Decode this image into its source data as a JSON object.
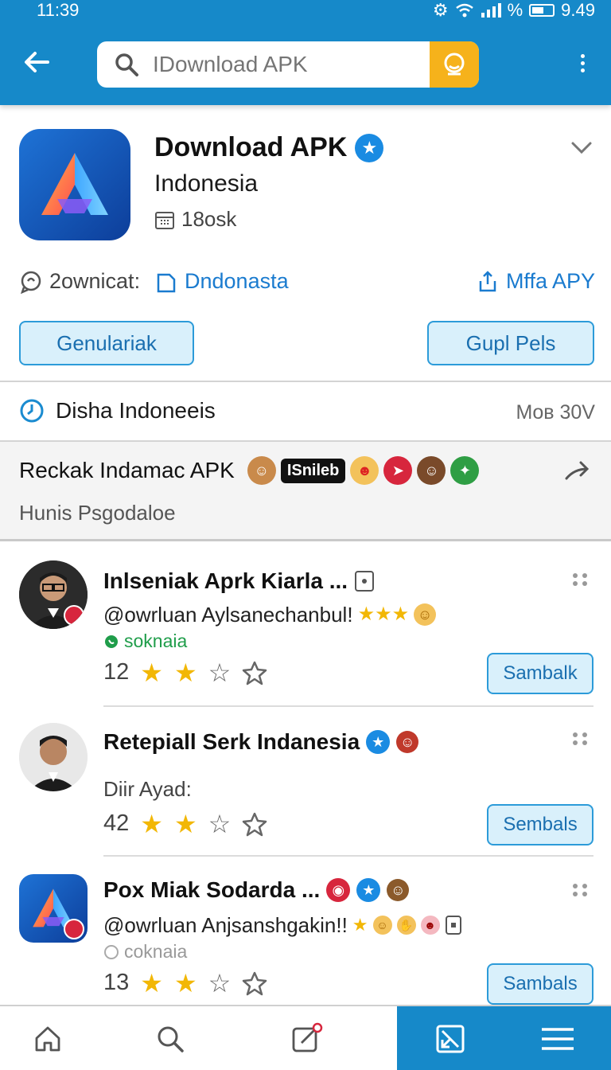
{
  "status_bar": {
    "time": "11:39",
    "percent_sign": "%",
    "battery_value": "9.49"
  },
  "search": {
    "placeholder": "IDownload APK"
  },
  "app": {
    "title": "Download APK",
    "subtitle": "Indonesia",
    "meta": "18osk",
    "info": {
      "downloads": "2ownicat:",
      "source": "Dndonasta",
      "share": "Mffa APY"
    },
    "buttons": {
      "left": "Genulariak",
      "right": "Gupl Pels"
    }
  },
  "time_row": {
    "label": "Disha Indoneeis",
    "value": "Moв 30V"
  },
  "recommend": {
    "title": "Reckak Indamac APK",
    "pill": "ISnileb",
    "subtitle": "Hunis Psgodaloe"
  },
  "reviews": [
    {
      "name": "Inlseniak Aprk Kiarla ...",
      "text": "@owrluan Aylsanechanbul!",
      "tag": "soknaia",
      "count": "12",
      "rating": 2,
      "button": "Sambalk"
    },
    {
      "name": "Retepiall Serk Indanesia",
      "text": "Diir Ayad:",
      "tag": "",
      "count": "42",
      "rating": 2,
      "button": "Sembals"
    },
    {
      "name": "Pox Miak Sodarda ...",
      "text": "@owrluan Anjsanshgakin!!",
      "tag": "coknaia",
      "count": "13",
      "rating": 2,
      "button": "Sambals"
    }
  ],
  "colors": {
    "primary": "#1689c9",
    "accent": "#f6b21b",
    "star": "#f2b705",
    "button_fill": "#d9f0fb"
  },
  "icons": [
    "back-arrow-icon",
    "search-icon",
    "mic-icon",
    "more-vert-icon",
    "verified-icon",
    "chevron-down-icon",
    "calendar-icon",
    "chat-icon",
    "file-icon",
    "share-icon",
    "clock-icon",
    "arrow-right-icon",
    "home-icon",
    "search-nav-icon",
    "compose-icon",
    "inbox-icon",
    "menu-icon"
  ]
}
